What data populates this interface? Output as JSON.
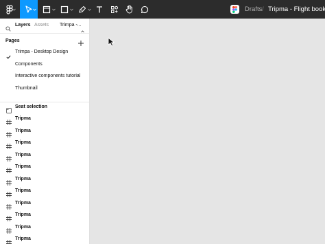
{
  "toolbar": {
    "tools": [
      {
        "name": "main-menu",
        "icon": "figma-logo-icon"
      },
      {
        "name": "move",
        "icon": "move-arrow-icon",
        "active": true
      },
      {
        "name": "frame",
        "icon": "frame-icon"
      },
      {
        "name": "shape",
        "icon": "rectangle-icon"
      },
      {
        "name": "pen",
        "icon": "pen-icon"
      },
      {
        "name": "text",
        "icon": "text-icon"
      },
      {
        "name": "resources",
        "icon": "resources-icon"
      },
      {
        "name": "hand",
        "icon": "hand-icon"
      },
      {
        "name": "comment",
        "icon": "comment-icon"
      }
    ],
    "active_color": "#0d99ff",
    "background_color": "#2c2c2c"
  },
  "breadcrumb": {
    "team": "Drafts",
    "separator": "/",
    "file": "Tripma - Flight booking"
  },
  "panel": {
    "tabs": {
      "layers": "Layers",
      "assets": "Assets",
      "page": "Trimpa -..."
    },
    "pages_title": "Pages",
    "pages": [
      {
        "label": "Trimpa - Desktop Design",
        "selected": true
      },
      {
        "label": "Components",
        "selected": false
      },
      {
        "label": "Interactive components tutorial",
        "selected": false
      },
      {
        "label": "Thumbnail",
        "selected": false
      }
    ],
    "layers": [
      {
        "label": "Seat selection",
        "icon": "section-icon"
      },
      {
        "label": "Tripma",
        "icon": "frame-icon"
      },
      {
        "label": "Tripma",
        "icon": "frame-icon"
      },
      {
        "label": "Tripma",
        "icon": "frame-icon"
      },
      {
        "label": "Tripma",
        "icon": "frame-icon"
      },
      {
        "label": "Tripma",
        "icon": "frame-icon"
      },
      {
        "label": "Tripma",
        "icon": "frame-icon"
      },
      {
        "label": "Tripma",
        "icon": "frame-icon"
      },
      {
        "label": "Tripma",
        "icon": "frame-icon"
      },
      {
        "label": "Tripma",
        "icon": "frame-icon"
      },
      {
        "label": "Tripma",
        "icon": "frame-icon"
      },
      {
        "label": "Tripma",
        "icon": "frame-icon"
      }
    ]
  },
  "canvas": {
    "background_color": "#e5e5e5"
  }
}
